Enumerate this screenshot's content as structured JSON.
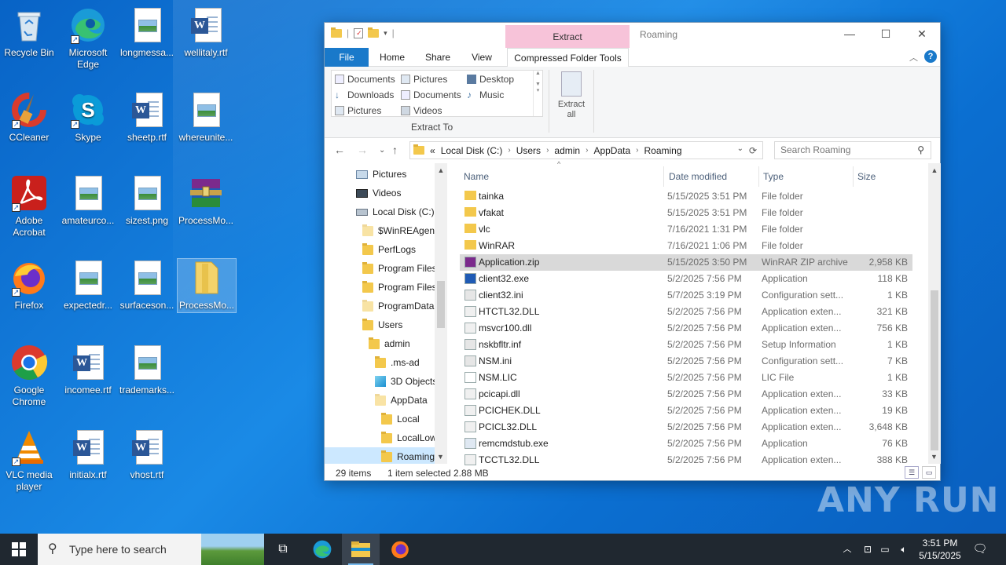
{
  "desktop": {
    "icons": [
      {
        "label": "Recycle Bin"
      },
      {
        "label": "Microsoft Edge"
      },
      {
        "label": "longmessa..."
      },
      {
        "label": "wellitaly.rtf"
      },
      {
        "label": "CCleaner"
      },
      {
        "label": "Skype"
      },
      {
        "label": "sheetp.rtf"
      },
      {
        "label": "whereunite..."
      },
      {
        "label": "Adobe Acrobat"
      },
      {
        "label": "amateurco..."
      },
      {
        "label": "sizest.png"
      },
      {
        "label": "ProcessMo..."
      },
      {
        "label": "Firefox"
      },
      {
        "label": "expectedr..."
      },
      {
        "label": "surfaceson..."
      },
      {
        "label": "ProcessMo..."
      },
      {
        "label": "Google Chrome"
      },
      {
        "label": "incomee.rtf"
      },
      {
        "label": "trademarks..."
      },
      {
        "label": "VLC media player"
      },
      {
        "label": "initialx.rtf"
      },
      {
        "label": "vhost.rtf"
      }
    ]
  },
  "window": {
    "title": "Roaming",
    "context_tab": "Extract",
    "tabs": [
      "File",
      "Home",
      "Share",
      "View",
      "Compressed Folder Tools"
    ],
    "extract_to": {
      "items": [
        "Documents",
        "Pictures",
        "Desktop",
        "Downloads",
        "Documents",
        "Music",
        "Pictures",
        "Videos"
      ],
      "label": "Extract To"
    },
    "extract_all": "Extract all",
    "address": {
      "prefix": "«",
      "path": [
        "Local Disk (C:)",
        "Users",
        "admin",
        "AppData",
        "Roaming"
      ]
    },
    "search_placeholder": "Search Roaming",
    "nav_pane": [
      {
        "label": "Pictures"
      },
      {
        "label": "Videos"
      },
      {
        "label": "Local Disk (C:)"
      },
      {
        "label": "$WinREAgent"
      },
      {
        "label": "PerfLogs"
      },
      {
        "label": "Program Files"
      },
      {
        "label": "Program Files"
      },
      {
        "label": "ProgramData"
      },
      {
        "label": "Users"
      },
      {
        "label": "admin"
      },
      {
        "label": ".ms-ad"
      },
      {
        "label": "3D Objects"
      },
      {
        "label": "AppData"
      },
      {
        "label": "Local"
      },
      {
        "label": "LocalLow"
      },
      {
        "label": "Roaming"
      }
    ],
    "columns": [
      "Name",
      "Date modified",
      "Type",
      "Size"
    ],
    "files": [
      {
        "name": "tainka",
        "date": "5/15/2025 3:51 PM",
        "type": "File folder",
        "size": "",
        "icon": "folder-icon"
      },
      {
        "name": "vfakat",
        "date": "5/15/2025 3:51 PM",
        "type": "File folder",
        "size": "",
        "icon": "folder-icon"
      },
      {
        "name": "vlc",
        "date": "7/16/2021 1:31 PM",
        "type": "File folder",
        "size": "",
        "icon": "folder-icon"
      },
      {
        "name": "WinRAR",
        "date": "7/16/2021 1:06 PM",
        "type": "File folder",
        "size": "",
        "icon": "folder-icon"
      },
      {
        "name": "Application.zip",
        "date": "5/15/2025 3:50 PM",
        "type": "WinRAR ZIP archive",
        "size": "2,958 KB",
        "icon": "winrar-archive-icon"
      },
      {
        "name": "client32.exe",
        "date": "5/2/2025 7:56 PM",
        "type": "Application",
        "size": "118 KB",
        "icon": "netsupport-app-icon"
      },
      {
        "name": "client32.ini",
        "date": "5/7/2025 3:19 PM",
        "type": "Configuration sett...",
        "size": "1 KB",
        "icon": "config-file-icon"
      },
      {
        "name": "HTCTL32.DLL",
        "date": "5/2/2025 7:56 PM",
        "type": "Application exten...",
        "size": "321 KB",
        "icon": "dll-file-icon"
      },
      {
        "name": "msvcr100.dll",
        "date": "5/2/2025 7:56 PM",
        "type": "Application exten...",
        "size": "756 KB",
        "icon": "dll-file-icon"
      },
      {
        "name": "nskbfltr.inf",
        "date": "5/2/2025 7:56 PM",
        "type": "Setup Information",
        "size": "1 KB",
        "icon": "config-file-icon"
      },
      {
        "name": "NSM.ini",
        "date": "5/2/2025 7:56 PM",
        "type": "Configuration sett...",
        "size": "7 KB",
        "icon": "config-file-icon"
      },
      {
        "name": "NSM.LIC",
        "date": "5/2/2025 7:56 PM",
        "type": "LIC File",
        "size": "1 KB",
        "icon": "blank-file-icon"
      },
      {
        "name": "pcicapi.dll",
        "date": "5/2/2025 7:56 PM",
        "type": "Application exten...",
        "size": "33 KB",
        "icon": "dll-file-icon"
      },
      {
        "name": "PCICHEK.DLL",
        "date": "5/2/2025 7:56 PM",
        "type": "Application exten...",
        "size": "19 KB",
        "icon": "dll-file-icon"
      },
      {
        "name": "PCICL32.DLL",
        "date": "5/2/2025 7:56 PM",
        "type": "Application exten...",
        "size": "3,648 KB",
        "icon": "dll-file-icon"
      },
      {
        "name": "remcmdstub.exe",
        "date": "5/2/2025 7:56 PM",
        "type": "Application",
        "size": "76 KB",
        "icon": "exe-file-icon"
      },
      {
        "name": "TCCTL32.DLL",
        "date": "5/2/2025 7:56 PM",
        "type": "Application exten...",
        "size": "388 KB",
        "icon": "dll-file-icon"
      }
    ],
    "status": {
      "count": "29 items",
      "selected": "1 item selected",
      "size": "2.88 MB"
    }
  },
  "taskbar": {
    "search_placeholder": "Type here to search",
    "time": "3:51 PM",
    "date": "5/15/2025"
  },
  "watermark": "ANY RUN",
  "colors": {
    "accent": "#1979ca",
    "context_tab": "#f7c3d9",
    "folder": "#f3c84c",
    "taskbar": "#202830"
  }
}
